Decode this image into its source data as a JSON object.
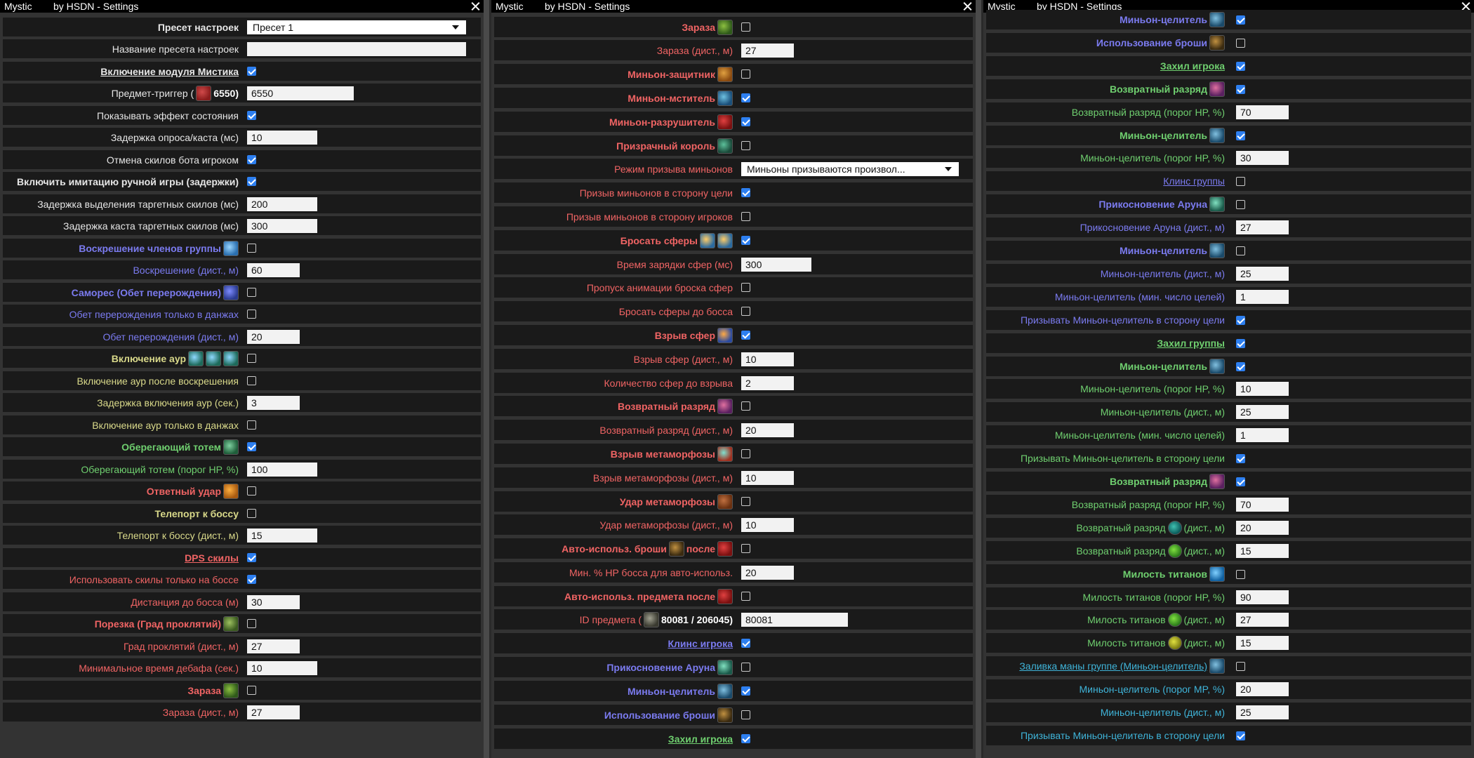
{
  "window": {
    "app": "Mystic",
    "subtitle": "by HSDN - Settings"
  },
  "colors": {
    "white": "#e6e6e6",
    "blue": "#7b7bf0",
    "yellow": "#d9d98a",
    "green": "#6fcf6f",
    "red": "#f06464",
    "cyan": "#3fb4d9",
    "check_on": "#2d7ff0"
  },
  "panels": [
    {
      "rows": [
        {
          "label": "Пресет настроек",
          "style": "b",
          "color": "white",
          "ctrl": "select",
          "value": "Пресет 1"
        },
        {
          "label": "Название пресета настроек",
          "color": "white",
          "ctrl": "text",
          "value": ""
        },
        {
          "label": "Включение модуля Мистика",
          "style": "bu",
          "color": "white",
          "ctrl": "check",
          "checked": true
        },
        {
          "label": "Предмет-триггер (",
          "icon": "feather-icon",
          "suffix": "6550)",
          "color": "white",
          "ctrl": "text",
          "value": "6550"
        },
        {
          "label": "Показывать эффект состояния",
          "color": "white",
          "ctrl": "check",
          "checked": true
        },
        {
          "label": "Задержка опроса/каста (мс)",
          "color": "white",
          "ctrl": "text",
          "value": "10"
        },
        {
          "label": "Отмена скилов бота игроком",
          "color": "white",
          "ctrl": "check",
          "checked": true
        },
        {
          "label": "Включить имитацию ручной игры (задержки)",
          "style": "b",
          "color": "white",
          "ctrl": "check",
          "checked": true
        },
        {
          "label": "Задержка выделения таргетных скилов (мс)",
          "color": "white",
          "ctrl": "text",
          "value": "200"
        },
        {
          "label": "Задержка каста таргетных скилов (мс)",
          "color": "white",
          "ctrl": "text",
          "value": "300"
        },
        {
          "label": "Воскрешение членов группы",
          "style": "b",
          "color": "blue",
          "icons": [
            "resurrection-skill-icon"
          ],
          "ctrl": "check",
          "checked": false
        },
        {
          "label": "Воскрешение (дист., м)",
          "color": "blue",
          "ctrl": "text",
          "value": "60"
        },
        {
          "label": "Самореc (Обет перерождения)",
          "style": "b",
          "color": "blue",
          "icons": [
            "vow-of-rebirth-skill-icon"
          ],
          "ctrl": "check",
          "checked": false
        },
        {
          "label": "Обет перерождения только в данжах",
          "color": "blue",
          "ctrl": "check",
          "checked": false
        },
        {
          "label": "Обет перерождения (дист., м)",
          "color": "blue",
          "ctrl": "text",
          "value": "20"
        },
        {
          "label": "Включение аур",
          "style": "b",
          "color": "yellow",
          "icons": [
            "aura-skill-icon",
            "aura-skill-icon",
            "aura-skill-icon"
          ],
          "ctrl": "check",
          "checked": false
        },
        {
          "label": "Включение аур после воскрешения",
          "color": "yellow",
          "ctrl": "check",
          "checked": false
        },
        {
          "label": "Задержка включения аур (сек.)",
          "color": "yellow",
          "ctrl": "text",
          "value": "3"
        },
        {
          "label": "Включение аур только в данжах",
          "color": "yellow",
          "ctrl": "check",
          "checked": false
        },
        {
          "label": "Оберегающий тотем",
          "style": "b",
          "color": "green",
          "icons": [
            "totem-skill-icon"
          ],
          "ctrl": "check",
          "checked": true
        },
        {
          "label": "Оберегающий тотем (порог HP, %)",
          "color": "green",
          "ctrl": "text",
          "value": "100"
        },
        {
          "label": "Ответный удар",
          "style": "b",
          "color": "red",
          "icons": [
            "retaliate-skill-icon"
          ],
          "ctrl": "check",
          "checked": false
        },
        {
          "label": "Телепорт к боссу",
          "style": "b",
          "color": "yellow",
          "ctrl": "check",
          "checked": false
        },
        {
          "label": "Телепорт к боссу (дист., м)",
          "color": "yellow",
          "ctrl": "text",
          "value": "15"
        },
        {
          "label": "DPS скилы",
          "style": "bu",
          "color": "red",
          "ctrl": "check",
          "checked": true
        },
        {
          "label": "Использовать скилы только на боссе",
          "color": "red",
          "ctrl": "check",
          "checked": true
        },
        {
          "label": "Дистанция до босса (м)",
          "color": "red",
          "ctrl": "text",
          "value": "30"
        },
        {
          "label": "Порезка (Град проклятий)",
          "style": "b",
          "color": "red",
          "icons": [
            "curse-hail-skill-icon"
          ],
          "ctrl": "check",
          "checked": false
        },
        {
          "label": "Град проклятий (дист., м)",
          "color": "red",
          "ctrl": "text",
          "value": "27"
        },
        {
          "label": "Минимальное время дебафа (сек.)",
          "color": "red",
          "ctrl": "text",
          "value": "10"
        },
        {
          "label": "Зараза",
          "style": "b",
          "color": "red",
          "icons": [
            "contagion-skill-icon"
          ],
          "ctrl": "check",
          "checked": false
        },
        {
          "label": "Зараза (дист., м)",
          "color": "red",
          "ctrl": "text",
          "value": "27"
        }
      ]
    },
    {
      "rows": [
        {
          "label": "Зараза",
          "style": "b",
          "color": "red",
          "icons": [
            "contagion-skill-icon"
          ],
          "ctrl": "check",
          "checked": false
        },
        {
          "label": "Зараза (дист., м)",
          "color": "red",
          "ctrl": "text",
          "value": "27"
        },
        {
          "label": "Миньон-защитник",
          "style": "b",
          "color": "red",
          "icons": [
            "guardian-minion-skill-icon"
          ],
          "ctrl": "check",
          "checked": false
        },
        {
          "label": "Миньон-мститель",
          "style": "b",
          "color": "red",
          "icons": [
            "avenger-minion-skill-icon"
          ],
          "ctrl": "check",
          "checked": true
        },
        {
          "label": "Миньон-разрушитель",
          "style": "b",
          "color": "red",
          "icons": [
            "destroyer-minion-skill-icon"
          ],
          "ctrl": "check",
          "checked": true
        },
        {
          "label": "Призрачный король",
          "style": "b",
          "color": "red",
          "icons": [
            "phantom-king-skill-icon"
          ],
          "ctrl": "check",
          "checked": false
        },
        {
          "label": "Режим призыва миньонов",
          "color": "red",
          "ctrl": "select",
          "value": "Миньоны призываются произвол..."
        },
        {
          "label": "Призыв миньонов в сторону цели",
          "color": "red",
          "ctrl": "check",
          "checked": true
        },
        {
          "label": "Призыв миньонов в сторону игроков",
          "color": "red",
          "ctrl": "check",
          "checked": false
        },
        {
          "label": "Бросать сферы",
          "style": "b",
          "color": "red",
          "icons": [
            "sphere-skill-icon",
            "sphere-skill-icon"
          ],
          "ctrl": "check",
          "checked": true
        },
        {
          "label": "Время зарядки сфер (мс)",
          "color": "red",
          "ctrl": "text",
          "value": "300"
        },
        {
          "label": "Пропуск анимации броска сфер",
          "color": "red",
          "ctrl": "check",
          "checked": false
        },
        {
          "label": "Бросать сферы до босса",
          "color": "red",
          "ctrl": "check",
          "checked": false
        },
        {
          "label": "Взрыв сфер",
          "style": "b",
          "color": "red",
          "icons": [
            "sphere-burst-skill-icon"
          ],
          "ctrl": "check",
          "checked": true
        },
        {
          "label": "Взрыв сфер (дист., м)",
          "color": "red",
          "ctrl": "text",
          "value": "10"
        },
        {
          "label": "Количество сфер до взрыва",
          "color": "red",
          "ctrl": "text",
          "value": "2"
        },
        {
          "label": "Возвратный разряд",
          "style": "b",
          "color": "red",
          "icons": [
            "return-discharge-skill-icon"
          ],
          "ctrl": "check",
          "checked": false
        },
        {
          "label": "Возвратный разряд (дист., м)",
          "color": "red",
          "ctrl": "text",
          "value": "20"
        },
        {
          "label": "Взрыв метаморфозы",
          "style": "b",
          "color": "red",
          "icons": [
            "metamorphosis-burst-skill-icon"
          ],
          "ctrl": "check",
          "checked": false
        },
        {
          "label": "Взрыв метаморфозы (дист., м)",
          "color": "red",
          "ctrl": "text",
          "value": "10"
        },
        {
          "label": "Удар метаморфозы",
          "style": "b",
          "color": "red",
          "icons": [
            "metamorphosis-strike-skill-icon"
          ],
          "ctrl": "check",
          "checked": false
        },
        {
          "label": "Удар метаморфозы (дист., м)",
          "color": "red",
          "ctrl": "text",
          "value": "10"
        },
        {
          "label": "Авто-использ. броши",
          "icon": "brooch-skill-icon",
          "suffix": "после",
          "icon2": "destroyer-minion-skill-icon",
          "style": "b",
          "color": "red",
          "ctrl": "check",
          "checked": false
        },
        {
          "label": "Мин. % HP босса для авто-использ.",
          "color": "red",
          "ctrl": "text",
          "value": "20"
        },
        {
          "label": "Авто-использ. предмета после",
          "style": "b",
          "color": "red",
          "icons": [
            "destroyer-minion-skill-icon"
          ],
          "ctrl": "check",
          "checked": false
        },
        {
          "label": "ID предмета (",
          "icon": "item-icon",
          "suffix": "80081 / 206045)",
          "color": "red",
          "ctrl": "text",
          "value": "80081"
        },
        {
          "label": "Клинс игрока",
          "style": "bu",
          "color": "blue",
          "ctrl": "check",
          "checked": true
        },
        {
          "label": "Прикосновение Аруна",
          "style": "b",
          "color": "blue",
          "icons": [
            "arun-touch-skill-icon"
          ],
          "ctrl": "check",
          "checked": false
        },
        {
          "label": "Миньон-целитель",
          "style": "b",
          "color": "blue",
          "icons": [
            "healer-minion-skill-icon"
          ],
          "ctrl": "check",
          "checked": true
        },
        {
          "label": "Использование броши",
          "style": "b",
          "color": "blue",
          "icons": [
            "brooch-skill-icon"
          ],
          "ctrl": "check",
          "checked": false
        },
        {
          "label": "Захил игрока",
          "style": "bu",
          "color": "green",
          "ctrl": "check",
          "checked": true
        }
      ]
    },
    {
      "rows": [
        {
          "label": "Миньон-целитель",
          "style": "b",
          "color": "blue",
          "icons": [
            "healer-minion-skill-icon"
          ],
          "ctrl": "check",
          "checked": true
        },
        {
          "label": "Использование броши",
          "style": "b",
          "color": "blue",
          "icons": [
            "brooch-skill-icon"
          ],
          "ctrl": "check",
          "checked": false
        },
        {
          "label": "Захил игрока",
          "style": "bu",
          "color": "green",
          "ctrl": "check",
          "checked": true
        },
        {
          "label": "Возвратный разряд",
          "style": "b",
          "color": "green",
          "icons": [
            "return-discharge-skill-icon"
          ],
          "ctrl": "check",
          "checked": true
        },
        {
          "label": "Возвратный разряд (порог HP, %)",
          "color": "green",
          "ctrl": "text",
          "value": "70"
        },
        {
          "label": "Миньон-целитель",
          "style": "b",
          "color": "green",
          "icons": [
            "healer-minion-skill-icon"
          ],
          "ctrl": "check",
          "checked": true
        },
        {
          "label": "Миньон-целитель (порог HP, %)",
          "color": "green",
          "ctrl": "text",
          "value": "30"
        },
        {
          "label": "Клинс группы",
          "style": "u",
          "color": "blue",
          "ctrl": "check",
          "checked": false
        },
        {
          "label": "Прикосновение Аруна",
          "style": "b",
          "color": "blue",
          "icons": [
            "arun-touch-skill-icon"
          ],
          "ctrl": "check",
          "checked": false
        },
        {
          "label": "Прикосновение Аруна (дист., м)",
          "color": "blue",
          "ctrl": "text",
          "value": "27"
        },
        {
          "label": "Миньон-целитель",
          "style": "b",
          "color": "blue",
          "icons": [
            "healer-minion-skill-icon"
          ],
          "ctrl": "check",
          "checked": false
        },
        {
          "label": "Миньон-целитель (дист., м)",
          "color": "blue",
          "ctrl": "text",
          "value": "25"
        },
        {
          "label": "Миньон-целитель (мин. число целей)",
          "color": "blue",
          "ctrl": "text",
          "value": "1"
        },
        {
          "label": "Призывать Миньон-целитель в сторону цели",
          "color": "blue",
          "ctrl": "check",
          "checked": true
        },
        {
          "label": "Захил группы",
          "style": "bu",
          "color": "green",
          "ctrl": "check",
          "checked": true
        },
        {
          "label": "Миньон-целитель",
          "style": "b",
          "color": "green",
          "icons": [
            "healer-minion-skill-icon"
          ],
          "ctrl": "check",
          "checked": true
        },
        {
          "label": "Миньон-целитель (порог HP, %)",
          "color": "green",
          "ctrl": "text",
          "value": "10"
        },
        {
          "label": "Миньон-целитель (дист., м)",
          "color": "green",
          "ctrl": "text",
          "value": "25"
        },
        {
          "label": "Миньон-целитель (мин. число целей)",
          "color": "green",
          "ctrl": "text",
          "value": "1"
        },
        {
          "label": "Призывать Миньон-целитель в сторону цели",
          "color": "green",
          "ctrl": "check",
          "checked": true
        },
        {
          "label": "Возвратный разряд",
          "style": "b",
          "color": "green",
          "icons": [
            "return-discharge-skill-icon"
          ],
          "ctrl": "check",
          "checked": true
        },
        {
          "label": "Возвратный разряд (порог HP, %)",
          "color": "green",
          "ctrl": "text",
          "value": "70"
        },
        {
          "label": "Возвратный разряд",
          "icon": "teal-orb-icon",
          "suffix": "(дист., м)",
          "color": "green",
          "ctrl": "text",
          "value": "20"
        },
        {
          "label": "Возвратный разряд",
          "icon": "green-orb-icon",
          "suffix": "(дист., м)",
          "color": "green",
          "ctrl": "text",
          "value": "15"
        },
        {
          "label": "Милость титанов",
          "style": "b",
          "color": "green",
          "icons": [
            "titans-grace-skill-icon"
          ],
          "ctrl": "check",
          "checked": false
        },
        {
          "label": "Милость титанов (порог HP, %)",
          "color": "green",
          "ctrl": "text",
          "value": "90"
        },
        {
          "label": "Милость титанов",
          "icon": "green-orb-icon",
          "suffix": "(дист., м)",
          "color": "green",
          "ctrl": "text",
          "value": "27"
        },
        {
          "label": "Милость титанов",
          "icon": "yellow-orb-icon",
          "suffix": "(дист., м)",
          "color": "green",
          "ctrl": "text",
          "value": "15"
        },
        {
          "label": "Заливка маны группе (Миньон-целитель)",
          "style": "u",
          "color": "cyan",
          "icons": [
            "healer-minion-skill-icon"
          ],
          "ctrl": "check",
          "checked": false
        },
        {
          "label": "Миньон-целитель (порог MP, %)",
          "color": "cyan",
          "ctrl": "text",
          "value": "20"
        },
        {
          "label": "Миньон-целитель (дист., м)",
          "color": "cyan",
          "ctrl": "text",
          "value": "25"
        },
        {
          "label": "Призывать Миньон-целитель в сторону цели",
          "color": "cyan",
          "ctrl": "check",
          "checked": true
        }
      ]
    }
  ]
}
